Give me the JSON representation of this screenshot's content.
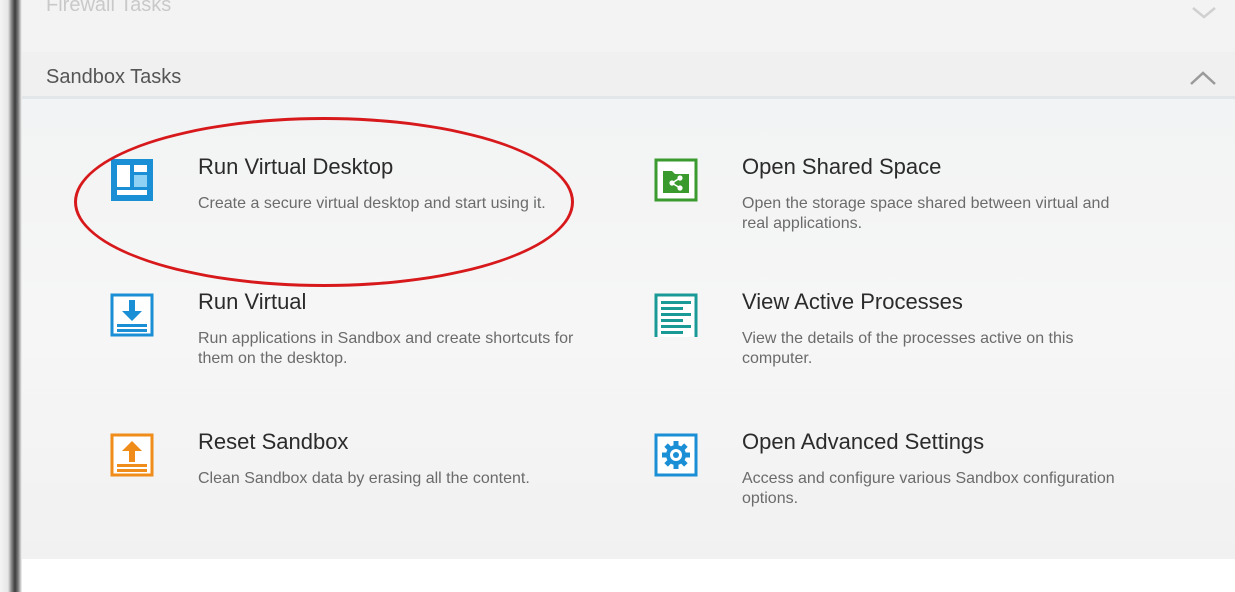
{
  "sections": {
    "previous": {
      "label": "Firewall Tasks"
    },
    "current": {
      "label": "Sandbox Tasks"
    }
  },
  "tasks": [
    {
      "title": "Run Virtual Desktop",
      "description": "Create a secure virtual desktop and start using it.",
      "icon": "virtual-desktop-icon",
      "color": "#1a8fd6"
    },
    {
      "title": "Open Shared Space",
      "description": "Open the storage space shared between virtual and real applications.",
      "icon": "shared-space-icon",
      "color": "#3a9a2d"
    },
    {
      "title": "Run Virtual",
      "description": "Run applications in Sandbox and create shortcuts for them on the desktop.",
      "icon": "run-virtual-icon",
      "color": "#1a8fd6"
    },
    {
      "title": "View Active Processes",
      "description": "View the details of the processes active on this computer.",
      "icon": "active-processes-icon",
      "color": "#1a9a96"
    },
    {
      "title": "Reset Sandbox",
      "description": "Clean Sandbox data by erasing all the content.",
      "icon": "reset-sandbox-icon",
      "color": "#f08c1a"
    },
    {
      "title": "Open Advanced Settings",
      "description": "Access and configure various Sandbox configuration options.",
      "icon": "advanced-settings-icon",
      "color": "#1a8fd6"
    }
  ],
  "highlight": {
    "color": "#d7191c"
  }
}
